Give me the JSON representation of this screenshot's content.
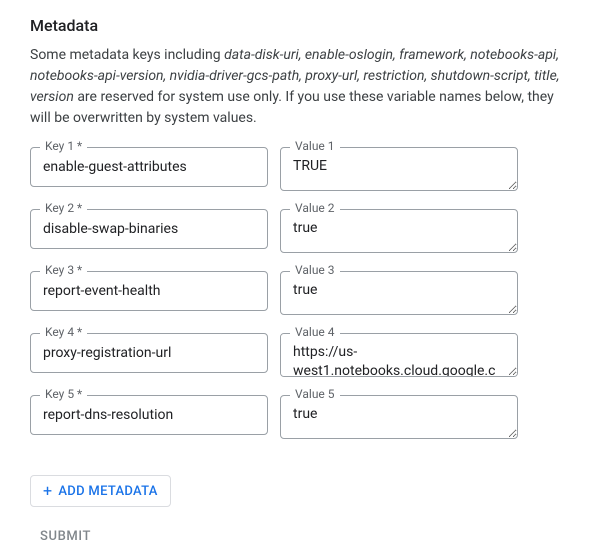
{
  "heading": "Metadata",
  "description_prefix": "Some metadata keys including ",
  "description_reserved": "data-disk-uri, enable-oslogin, framework, notebooks-api, notebooks-api-version, nvidia-driver-gcs-path, proxy-url, restriction, shutdown-script, title, version",
  "description_suffix": " are reserved for system use only. If you use these variable names below, they will be overwritten by system values.",
  "rows": [
    {
      "key_label": "Key 1 *",
      "key_value": "enable-guest-attributes",
      "value_label": "Value 1",
      "value_value": "TRUE"
    },
    {
      "key_label": "Key 2 *",
      "key_value": "disable-swap-binaries",
      "value_label": "Value 2",
      "value_value": "true"
    },
    {
      "key_label": "Key 3 *",
      "key_value": "report-event-health",
      "value_label": "Value 3",
      "value_value": "true"
    },
    {
      "key_label": "Key 4 *",
      "key_value": "proxy-registration-url",
      "value_label": "Value 4",
      "value_value": "https://us-west1.notebooks.cloud.google.c"
    },
    {
      "key_label": "Key 5 *",
      "key_value": "report-dns-resolution",
      "value_label": "Value 5",
      "value_value": "true"
    }
  ],
  "add_button_label": "ADD METADATA",
  "submit_label": "SUBMIT"
}
